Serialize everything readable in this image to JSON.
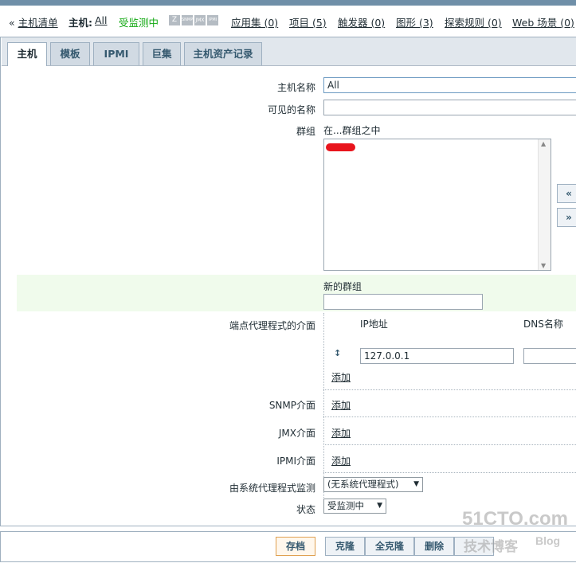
{
  "nav": {
    "host_list": "主机清单",
    "host_prefix": "主机:",
    "host_value": "All",
    "status": "受监测中",
    "apps": "应用集 (0)",
    "items": "项目 (5)",
    "triggers": "触发器 (0)",
    "graphs": "图形 (3)",
    "discovery": "探索规则 (0)",
    "web": "Web 场景 (0)",
    "availability_icons": [
      "Z",
      "SNMP",
      "JMX",
      "IPMI"
    ]
  },
  "tabs": [
    "主机",
    "模板",
    "IPMI",
    "巨集",
    "主机资产记录"
  ],
  "form": {
    "host_name_label": "主机名称",
    "host_name_value": "All",
    "visible_name_label": "可见的名称",
    "visible_name_value": "",
    "groups_label": "群组",
    "in_groups_label": "在...群组之中",
    "move_left": "«",
    "move_right": "»",
    "new_group_label": "新的群组",
    "new_group_value": "",
    "agent_if_label": "端点代理程式的介面",
    "ip_header": "IP地址",
    "dns_header": "DNS名称",
    "agent_ip_value": "127.0.0.1",
    "snmp_label": "SNMP介面",
    "jmx_label": "JMX介面",
    "ipmi_label": "IPMI介面",
    "add": "添加",
    "proxy_label": "由系统代理程式监测",
    "proxy_value": "(无系统代理程式)",
    "status_label": "状态",
    "status_value": "受监测中"
  },
  "buttons": {
    "save": "存档",
    "clone": "克隆",
    "full_clone": "全克隆",
    "delete": "删除"
  },
  "watermark": {
    "site": "51CTO.com",
    "sub": "技术博客",
    "blog": "Blog"
  },
  "colors": {
    "green_status": "#11a811",
    "new_group_bg": "#f0fbec",
    "tab_text": "#35596f",
    "header_strip": "#6f8fa8"
  }
}
